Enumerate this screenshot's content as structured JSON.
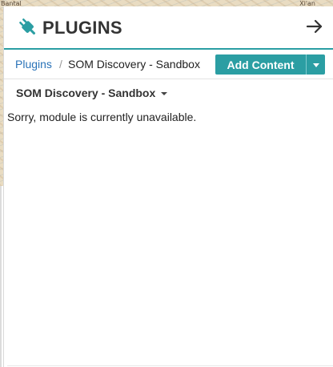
{
  "map": {
    "label_left": "Bantal",
    "label_right": "Xi'an"
  },
  "header": {
    "title": "PLUGINS",
    "icon": "plug-icon",
    "close_icon": "arrow-right-icon",
    "accent_color": "#2b9ea3"
  },
  "breadcrumb": {
    "root": "Plugins",
    "separator": "/",
    "current": "SOM Discovery - Sandbox"
  },
  "toolbar": {
    "add_content_label": "Add Content",
    "dropdown_icon": "caret-down-icon"
  },
  "module": {
    "title": "SOM Discovery - Sandbox",
    "message": "Sorry, module is currently unavailable."
  }
}
